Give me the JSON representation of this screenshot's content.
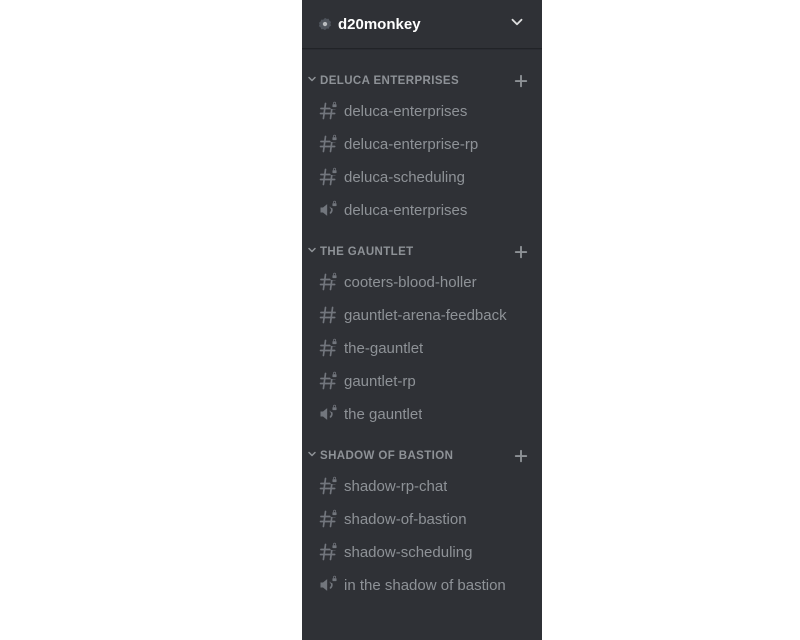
{
  "server": {
    "name": "d20monkey"
  },
  "categories": [
    {
      "name": "DELUCA ENTERPRISES",
      "channels": [
        {
          "name": "deluca-enterprises",
          "type": "text",
          "locked": true
        },
        {
          "name": "deluca-enterprise-rp",
          "type": "text",
          "locked": true
        },
        {
          "name": "deluca-scheduling",
          "type": "text",
          "locked": true
        },
        {
          "name": "deluca-enterprises",
          "type": "voice",
          "locked": true
        }
      ]
    },
    {
      "name": "THE GAUNTLET",
      "channels": [
        {
          "name": "cooters-blood-holler",
          "type": "text",
          "locked": true
        },
        {
          "name": "gauntlet-arena-feedback",
          "type": "text",
          "locked": false
        },
        {
          "name": "the-gauntlet",
          "type": "text",
          "locked": true
        },
        {
          "name": "gauntlet-rp",
          "type": "text",
          "locked": true
        },
        {
          "name": "the gauntlet",
          "type": "voice",
          "locked": true
        }
      ]
    },
    {
      "name": "SHADOW OF BASTION",
      "channels": [
        {
          "name": "shadow-rp-chat",
          "type": "text",
          "locked": true
        },
        {
          "name": "shadow-of-bastion",
          "type": "text",
          "locked": true
        },
        {
          "name": "shadow-scheduling",
          "type": "text",
          "locked": true
        },
        {
          "name": "in the shadow of bastion",
          "type": "voice",
          "locked": true
        }
      ]
    }
  ]
}
